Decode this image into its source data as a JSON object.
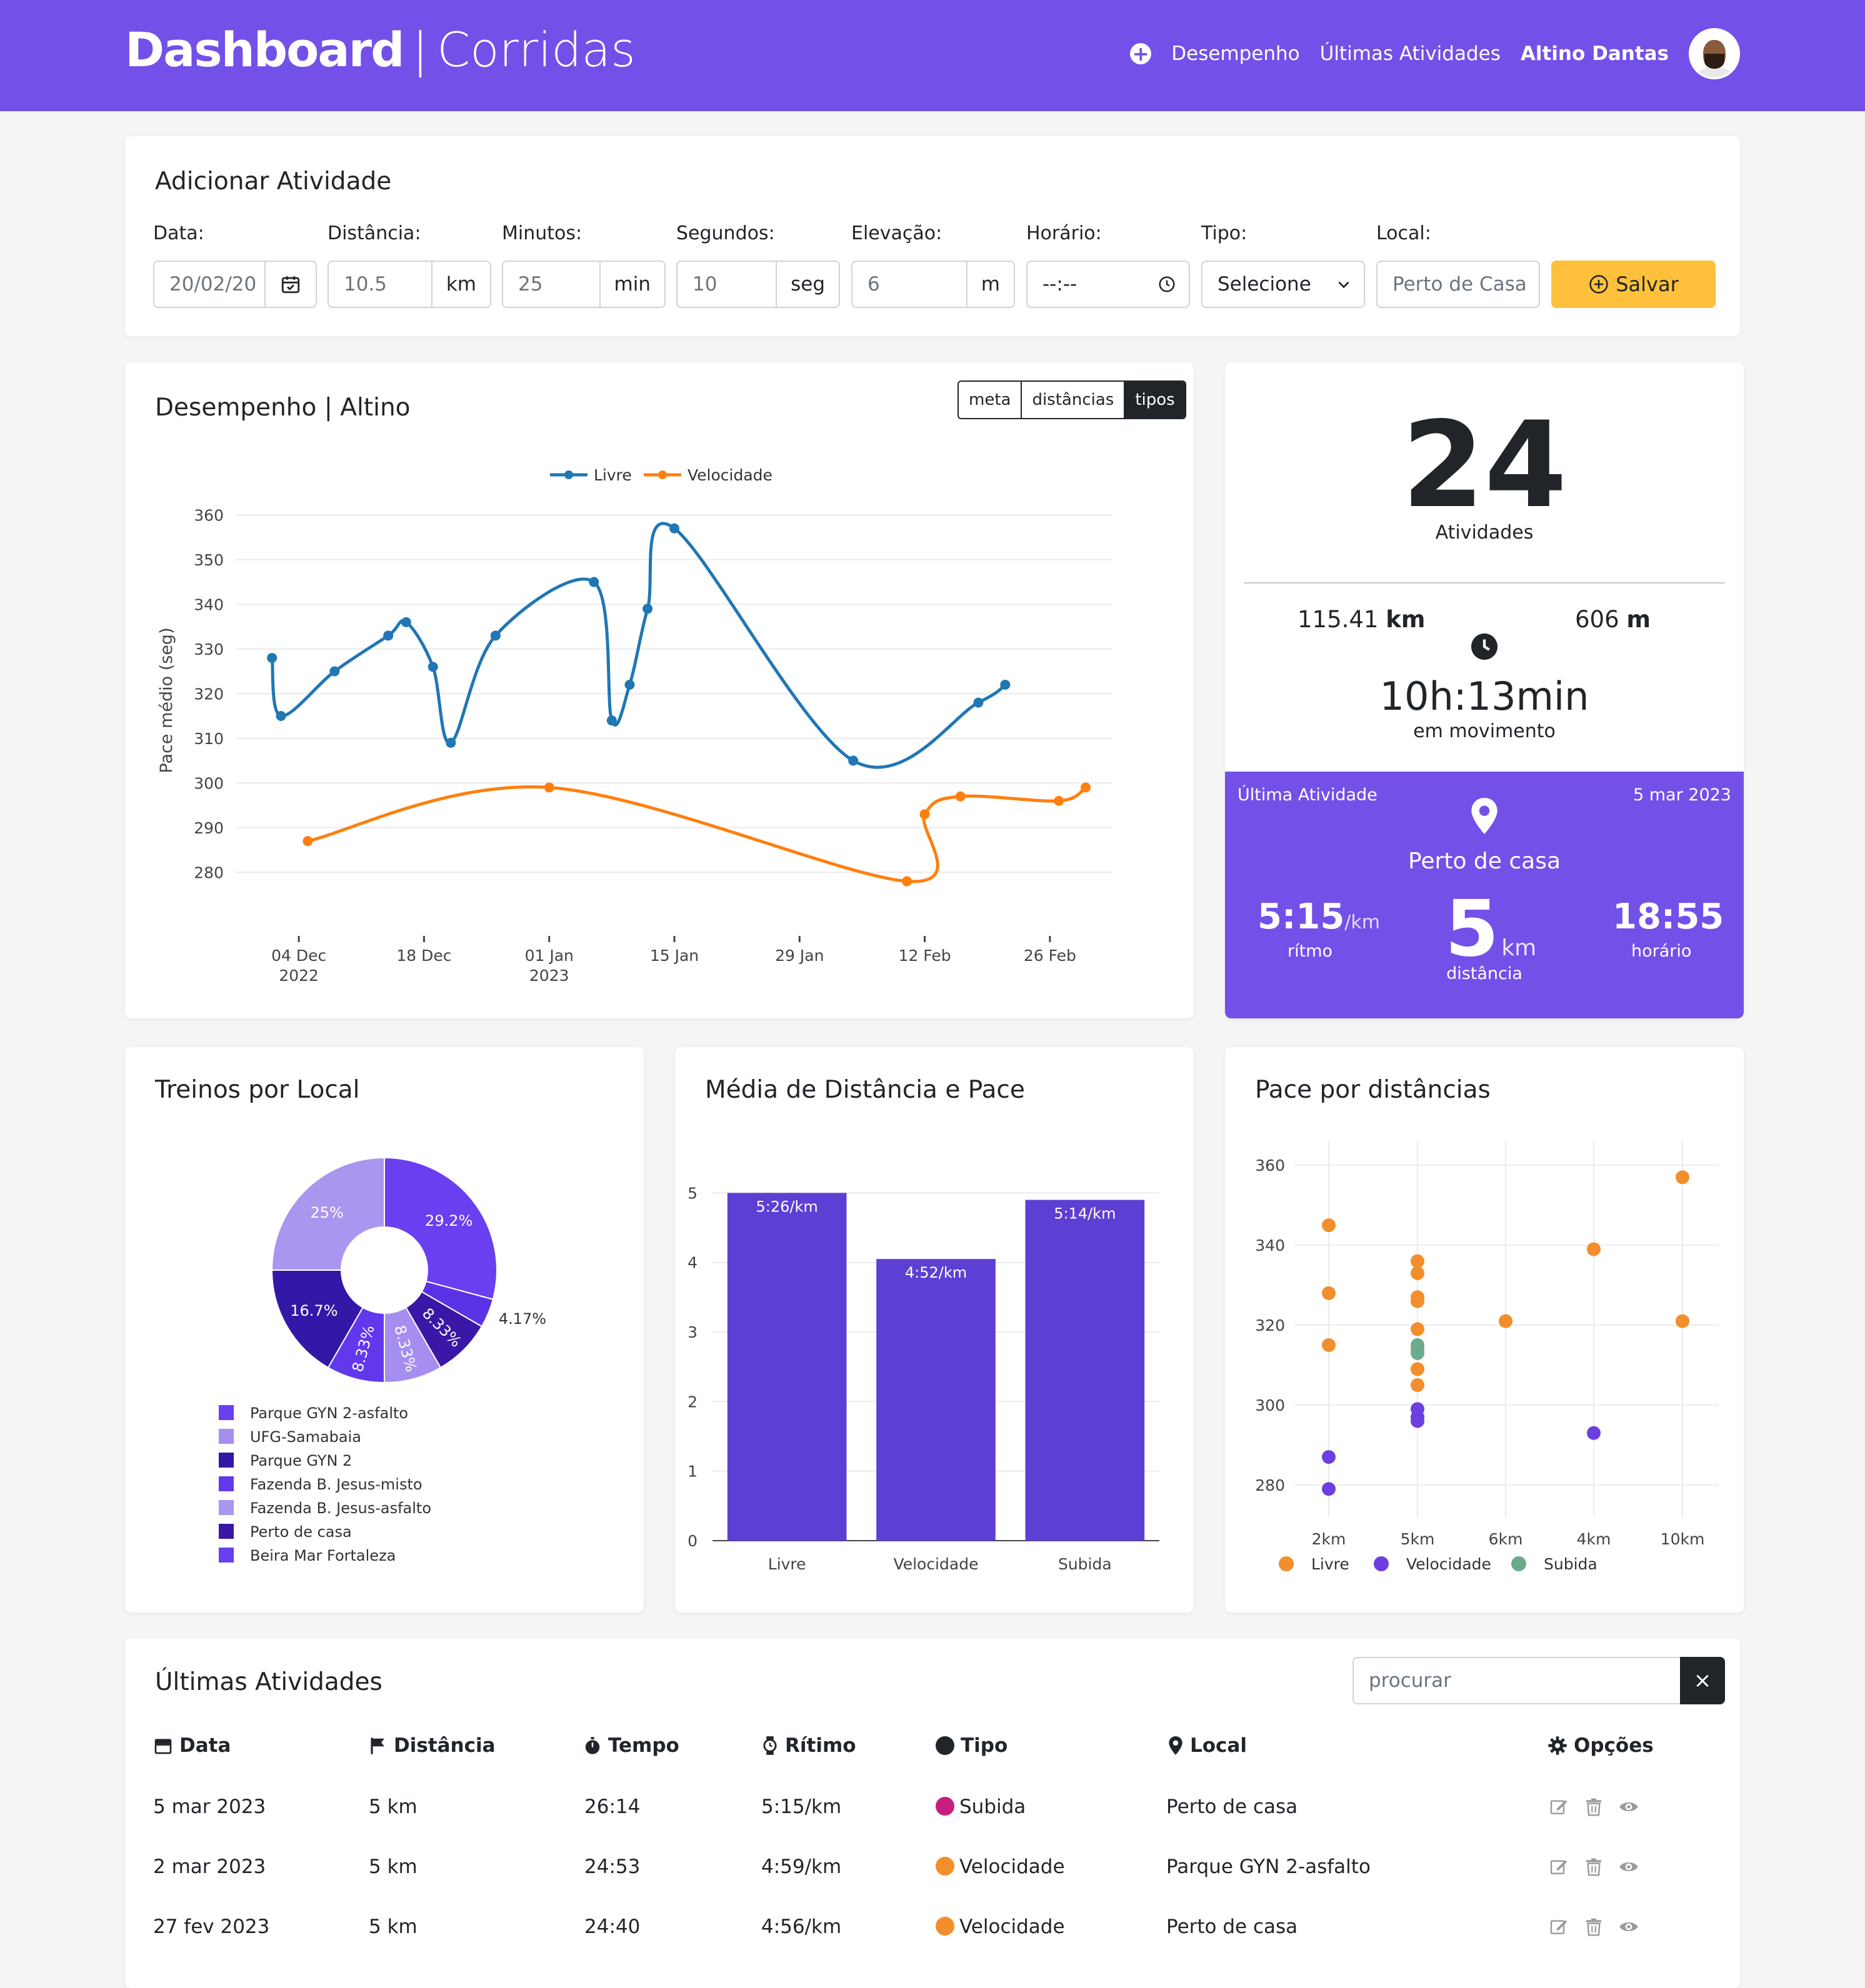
{
  "header": {
    "brand_bold": "Dashboard",
    "brand_sep": "|",
    "brand_light": "Corridas",
    "nav": [
      "Desempenho",
      "Últimas Atividades"
    ],
    "user": "Altino Dantas",
    "brand_color": "#7350e8"
  },
  "form": {
    "title": "Adicionar Atividade",
    "fields": [
      {
        "label": "Data:",
        "value": "20/02/20",
        "icon": "calendar-icon"
      },
      {
        "label": "Distância:",
        "value": "10.5",
        "unit": "km"
      },
      {
        "label": "Minutos:",
        "value": "25",
        "unit": "min"
      },
      {
        "label": "Segundos:",
        "value": "10",
        "unit": "seg"
      },
      {
        "label": "Elevação:",
        "value": "6",
        "unit": "m"
      },
      {
        "label": "Horário:",
        "value": "--:--",
        "icon": "clock-icon"
      },
      {
        "label": "Tipo:",
        "value": "Selecione",
        "icon": "chevron-down-icon"
      },
      {
        "label": "Local:",
        "placeholder": "Perto de Casa"
      }
    ],
    "save_label": "Salvar",
    "save_color": "#ffc13b"
  },
  "performance": {
    "title": "Desempenho | Altino",
    "toggle": [
      "meta",
      "distâncias",
      "tipos"
    ],
    "active_toggle": "tipos"
  },
  "summary": {
    "count": "24",
    "count_label": "Atividades",
    "distance_value": "115.41",
    "distance_unit": "km",
    "elevation_value": "606",
    "elevation_unit": "m",
    "moving_time": "10h:13min",
    "moving_label": "em movimento"
  },
  "last_activity": {
    "label": "Última Atividade",
    "date": "5 mar 2023",
    "place": "Perto de casa",
    "pace": "5:15",
    "pace_unit": "/km",
    "pace_label": "rítmo",
    "distance": "5",
    "distance_unit": "km",
    "distance_label": "distância",
    "time": "18:55",
    "time_label": "horário"
  },
  "charts": {
    "locations_title": "Treinos por Local",
    "bar_title": "Média de Distância e Pace",
    "scatter_title": "Pace por distâncias"
  },
  "chart_data": [
    {
      "type": "line",
      "ylabel": "Pace médio (seg)",
      "ylim": [
        275,
        362
      ],
      "yticks": [
        280,
        290,
        300,
        310,
        320,
        330,
        340,
        350,
        360
      ],
      "xticks": [
        {
          "date": "2022-12-04",
          "label": "04 Dec",
          "sub": "2022"
        },
        {
          "date": "2022-12-18",
          "label": "18 Dec",
          "sub": ""
        },
        {
          "date": "2023-01-01",
          "label": "01 Jan",
          "sub": "2023"
        },
        {
          "date": "2023-01-15",
          "label": "15 Jan",
          "sub": ""
        },
        {
          "date": "2023-01-29",
          "label": "29 Jan",
          "sub": ""
        },
        {
          "date": "2023-02-12",
          "label": "12 Feb",
          "sub": ""
        },
        {
          "date": "2023-02-26",
          "label": "26 Feb",
          "sub": ""
        }
      ],
      "legend": "top-center",
      "series": [
        {
          "name": "Livre",
          "color": "#1f77b4",
          "points": [
            [
              "2022-12-01",
              328
            ],
            [
              "2022-12-02",
              315
            ],
            [
              "2022-12-08",
              325
            ],
            [
              "2022-12-14",
              333
            ],
            [
              "2022-12-16",
              336
            ],
            [
              "2022-12-19",
              326
            ],
            [
              "2022-12-21",
              309
            ],
            [
              "2022-12-26",
              333
            ],
            [
              "2023-01-06",
              345
            ],
            [
              "2023-01-08",
              314
            ],
            [
              "2023-01-10",
              322
            ],
            [
              "2023-01-12",
              339
            ],
            [
              "2023-01-15",
              357
            ],
            [
              "2023-02-04",
              305
            ],
            [
              "2023-02-18",
              318
            ],
            [
              "2023-02-21",
              322
            ]
          ]
        },
        {
          "name": "Velocidade",
          "color": "#ff7f0e",
          "points": [
            [
              "2022-12-05",
              287
            ],
            [
              "2023-01-01",
              299
            ],
            [
              "2023-02-10",
              278
            ],
            [
              "2023-02-12",
              293
            ],
            [
              "2023-02-16",
              297
            ],
            [
              "2023-02-27",
              296
            ],
            [
              "2023-03-02",
              299
            ]
          ]
        }
      ]
    },
    {
      "type": "pie",
      "slices": [
        {
          "name": "Parque GYN 2-asfalto",
          "value": 29.2,
          "label": "29.2%",
          "color": "#6a3ff0"
        },
        {
          "name": "UFG-Samabaia",
          "value": 4.17,
          "label": "4.17%",
          "color": "#5b33e6"
        },
        {
          "name": "Parque GYN 2",
          "value": 8.33,
          "label": "8.33%",
          "color": "#3a17a6"
        },
        {
          "name": "Fazenda B. Jesus-misto",
          "value": 8.33,
          "label": "8.33%",
          "color": "#a68ef0"
        },
        {
          "name": "Fazenda B. Jesus-asfalto",
          "value": 8.33,
          "label": "8.33%",
          "color": "#6238ec"
        },
        {
          "name": "Perto de casa",
          "value": 16.7,
          "label": "16.7%",
          "color": "#3318a8"
        },
        {
          "name": "Beira Mar Fortaleza",
          "value": 25,
          "label": "25%",
          "color": "#aa95ef"
        }
      ],
      "legend": [
        {
          "name": "Parque GYN 2-asfalto",
          "color": "#6a3ff0"
        },
        {
          "name": "UFG-Samabaia",
          "color": "#a68ef0"
        },
        {
          "name": "Parque GYN 2",
          "color": "#3318a8"
        },
        {
          "name": "Fazenda B. Jesus-misto",
          "color": "#6238ec"
        },
        {
          "name": "Fazenda B. Jesus-asfalto",
          "color": "#aa95ef"
        },
        {
          "name": "Perto de casa",
          "color": "#3a17a6"
        },
        {
          "name": "Beira Mar Fortaleza",
          "color": "#6a3ff0"
        }
      ]
    },
    {
      "type": "bar",
      "categories": [
        "Livre",
        "Velocidade",
        "Subida"
      ],
      "values": [
        5.0,
        4.05,
        4.9
      ],
      "data_labels": [
        "5:26/km",
        "4:52/km",
        "5:14/km"
      ],
      "ylim": [
        0,
        5.3
      ],
      "yticks": [
        0,
        1,
        2,
        3,
        4,
        5
      ],
      "color": "#5d3fd3"
    },
    {
      "type": "scatter",
      "categories": [
        "2km",
        "5km",
        "6km",
        "4km",
        "10km"
      ],
      "ylim": [
        272,
        363
      ],
      "yticks": [
        280,
        300,
        320,
        340,
        360
      ],
      "legend": "bottom-center",
      "series": [
        {
          "name": "Livre",
          "color": "#f28e2b",
          "points": [
            [
              "2km",
              345
            ],
            [
              "2km",
              328
            ],
            [
              "2km",
              315
            ],
            [
              "5km",
              336
            ],
            [
              "5km",
              333
            ],
            [
              "5km",
              327
            ],
            [
              "5km",
              326
            ],
            [
              "5km",
              319
            ],
            [
              "5km",
              314
            ],
            [
              "5km",
              309
            ],
            [
              "5km",
              305
            ],
            [
              "6km",
              321
            ],
            [
              "4km",
              339
            ],
            [
              "10km",
              357
            ],
            [
              "10km",
              321
            ]
          ]
        },
        {
          "name": "Velocidade",
          "color": "#6d3fe0",
          "points": [
            [
              "2km",
              287
            ],
            [
              "2km",
              279
            ],
            [
              "5km",
              299
            ],
            [
              "5km",
              297
            ],
            [
              "5km",
              296
            ],
            [
              "4km",
              293
            ]
          ]
        },
        {
          "name": "Subida",
          "color": "#6aab8e",
          "points": [
            [
              "5km",
              315
            ],
            [
              "5km",
              313
            ]
          ]
        }
      ]
    }
  ],
  "activities": {
    "title": "Últimas Atividades",
    "search_placeholder": "procurar",
    "clear_label": "×",
    "columns": [
      "Data",
      "Distância",
      "Tempo",
      "Rítimo",
      "Tipo",
      "Local",
      "Opções"
    ],
    "rows": [
      {
        "date": "5 mar 2023",
        "distance": "5 km",
        "time": "26:14",
        "pace": "5:15/km",
        "type": "Subida",
        "type_color": "#c71f7d",
        "place": "Perto de casa"
      },
      {
        "date": "2 mar 2023",
        "distance": "5 km",
        "time": "24:53",
        "pace": "4:59/km",
        "type": "Velocidade",
        "type_color": "#f28e2b",
        "place": "Parque GYN 2-asfalto"
      },
      {
        "date": "27 fev 2023",
        "distance": "5 km",
        "time": "24:40",
        "pace": "4:56/km",
        "type": "Velocidade",
        "type_color": "#f28e2b",
        "place": "Perto de casa"
      }
    ]
  }
}
